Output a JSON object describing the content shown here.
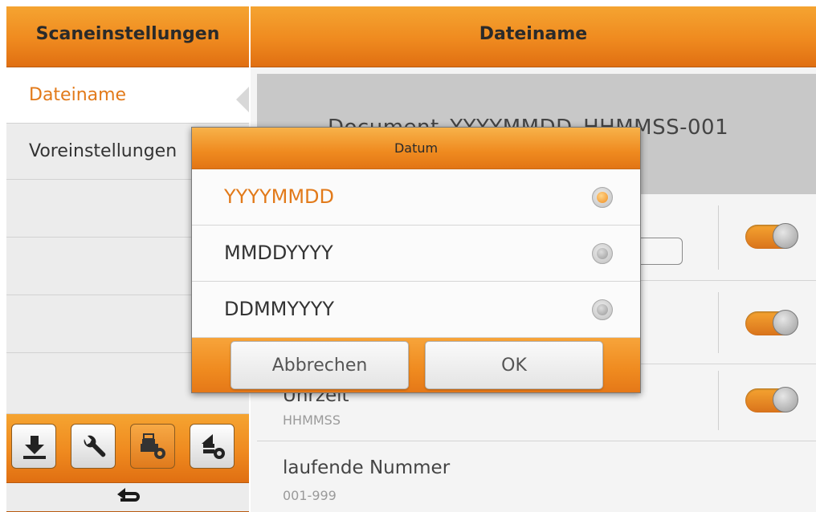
{
  "sidebar": {
    "title": "Scaneinstellungen",
    "items": [
      {
        "label": "Dateiname",
        "selected": true
      },
      {
        "label": "Voreinstellungen",
        "selected": false
      }
    ],
    "toolbar_icons": [
      "download-icon",
      "wrench-icon",
      "scanner-settings-icon",
      "upload-settings-icon"
    ],
    "back_icon": "back-arrow-icon"
  },
  "main": {
    "title": "Dateiname",
    "preview_text": "Document_YYYYMMDD_HHMMSS-001",
    "options": [
      {
        "name": "",
        "subtitle": "",
        "toggle_on": true
      },
      {
        "name": "",
        "subtitle": "",
        "toggle_on": true
      },
      {
        "name": "Uhrzeit",
        "subtitle": "HHMMSS",
        "toggle_on": true
      },
      {
        "name": "laufende Nummer",
        "subtitle": "001-999"
      }
    ]
  },
  "dialog": {
    "title": "Datum",
    "options": [
      {
        "label": "YYYYMMDD",
        "selected": true
      },
      {
        "label": "MMDDYYYY",
        "selected": false
      },
      {
        "label": "DDMMYYYY",
        "selected": false
      }
    ],
    "cancel_label": "Abbrechen",
    "ok_label": "OK"
  },
  "colors": {
    "accent": "#ef8a1f",
    "selected_text": "#e27a1a",
    "sidebar_bg": "#ececec"
  }
}
